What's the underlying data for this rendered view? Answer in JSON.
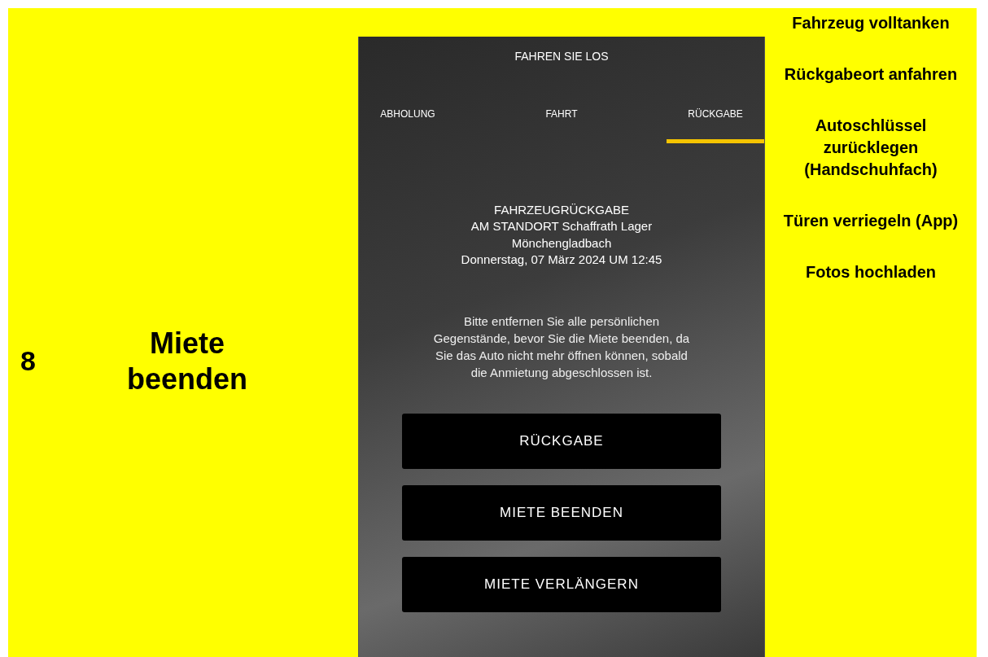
{
  "slide_number": "8",
  "step_title": "Miete beenden",
  "phone": {
    "title": "FAHREN SIE LOS",
    "tabs": [
      {
        "label": "ABHOLUNG",
        "selected": false
      },
      {
        "label": "FAHRT",
        "selected": false
      },
      {
        "label": "RÜCKGABE",
        "selected": true
      }
    ],
    "return_info": [
      "FAHRZEUGRÜCKGABE",
      "AM STANDORT Schaffrath Lager",
      "Mönchengladbach",
      "Donnerstag, 07 März 2024 UM 12:45"
    ],
    "notice": "Bitte entfernen Sie alle persönlichen Gegenstände, bevor Sie die Miete beenden, da Sie das Auto nicht mehr öffnen können, sobald die Anmietung abgeschlossen ist.",
    "buttons": [
      "RÜCKGABE",
      "MIETE BEENDEN",
      "MIETE VERLÄNGERN"
    ]
  },
  "checklist": [
    "Fahrzeug volltanken",
    "Rückgabeort anfahren",
    "Autoschlüssel zurücklegen (Handschuhfach)",
    "Türen verriegeln (App)",
    "Fotos hochladen"
  ]
}
